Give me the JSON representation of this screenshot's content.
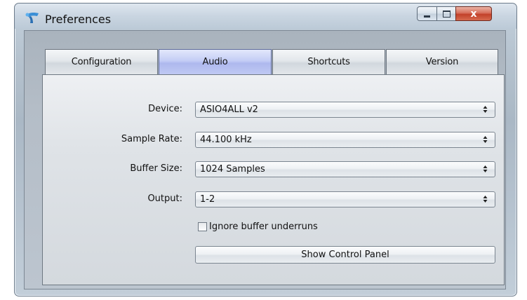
{
  "window": {
    "title": "Preferences",
    "controls": {
      "minimize": "minimize",
      "maximize": "maximize",
      "close": "x"
    }
  },
  "tabs": [
    {
      "label": "Configuration",
      "active": false
    },
    {
      "label": "Audio",
      "active": true
    },
    {
      "label": "Shortcuts",
      "active": false
    },
    {
      "label": "Version",
      "active": false
    }
  ],
  "audio": {
    "device": {
      "label": "Device:",
      "value": "ASIO4ALL v2"
    },
    "sample_rate": {
      "label": "Sample Rate:",
      "value": "44.100 kHz"
    },
    "buffer_size": {
      "label": "Buffer Size:",
      "value": "1024 Samples"
    },
    "output": {
      "label": "Output:",
      "value": "1-2"
    },
    "ignore_underruns": {
      "label": "Ignore buffer underruns",
      "checked": false
    },
    "control_panel_button": "Show Control Panel"
  },
  "colors": {
    "active_tab": "#aeb9ee",
    "close_button": "#c2412a"
  }
}
